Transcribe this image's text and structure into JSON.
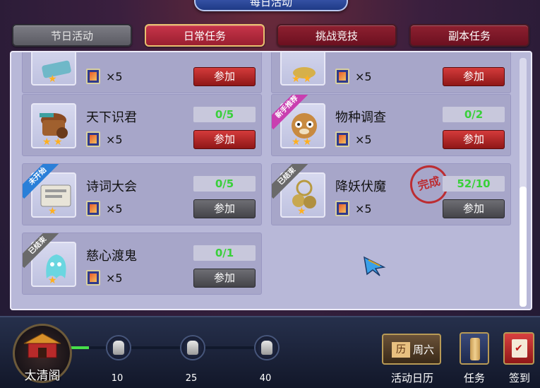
{
  "title": "每日活动",
  "tabs": [
    {
      "label": "节日活动",
      "state": "disabled"
    },
    {
      "label": "日常任务",
      "state": "active"
    },
    {
      "label": "挑战竞技",
      "state": "inactive"
    },
    {
      "label": "副本任务",
      "state": "inactive"
    }
  ],
  "cards": [
    {
      "name": "",
      "reward_count": "×5",
      "progress": "",
      "join_label": "参加",
      "join_style": "red",
      "ribbon": "",
      "stars": 1,
      "partial": true
    },
    {
      "name": "",
      "reward_count": "×5",
      "progress": "",
      "join_label": "参加",
      "join_style": "red",
      "ribbon": "",
      "stars": 2,
      "partial": true
    },
    {
      "name": "天下识君",
      "reward_count": "×5",
      "progress": "0/5",
      "join_label": "参加",
      "join_style": "red",
      "ribbon": "",
      "stars": 2
    },
    {
      "name": "物种调查",
      "reward_count": "×5",
      "progress": "0/2",
      "join_label": "参加",
      "join_style": "red",
      "ribbon": "新手推荐",
      "ribbon_color": "pink",
      "stars": 2
    },
    {
      "name": "诗词大会",
      "reward_count": "×5",
      "progress": "0/5",
      "join_label": "参加",
      "join_style": "gray",
      "ribbon": "未开始",
      "ribbon_color": "blue",
      "stars": 1
    },
    {
      "name": "降妖伏魔",
      "reward_count": "×5",
      "progress": "52/10",
      "join_label": "参加",
      "join_style": "gray",
      "ribbon": "已结束",
      "ribbon_color": "gray",
      "stars": 1,
      "stamp": "完成"
    },
    {
      "name": "慈心渡鬼",
      "reward_count": "×5",
      "progress": "0/1",
      "join_label": "参加",
      "join_style": "gray",
      "ribbon": "已结束",
      "ribbon_color": "gray",
      "stars": 1
    }
  ],
  "bottom": {
    "avatar_label": "太清阁",
    "milestones": [
      "10",
      "25",
      "40"
    ],
    "activity_progress_fraction": 0.09,
    "calendar_badge_left": "历",
    "calendar_badge_right": "周六",
    "calendar_label": "活动日历",
    "task_label": "任务",
    "signin_label": "签到"
  },
  "colors": {
    "progress_text": "#39d03a",
    "join_active": "#b52424",
    "join_inactive": "#55555a",
    "accent_tab": "#c8354a"
  }
}
